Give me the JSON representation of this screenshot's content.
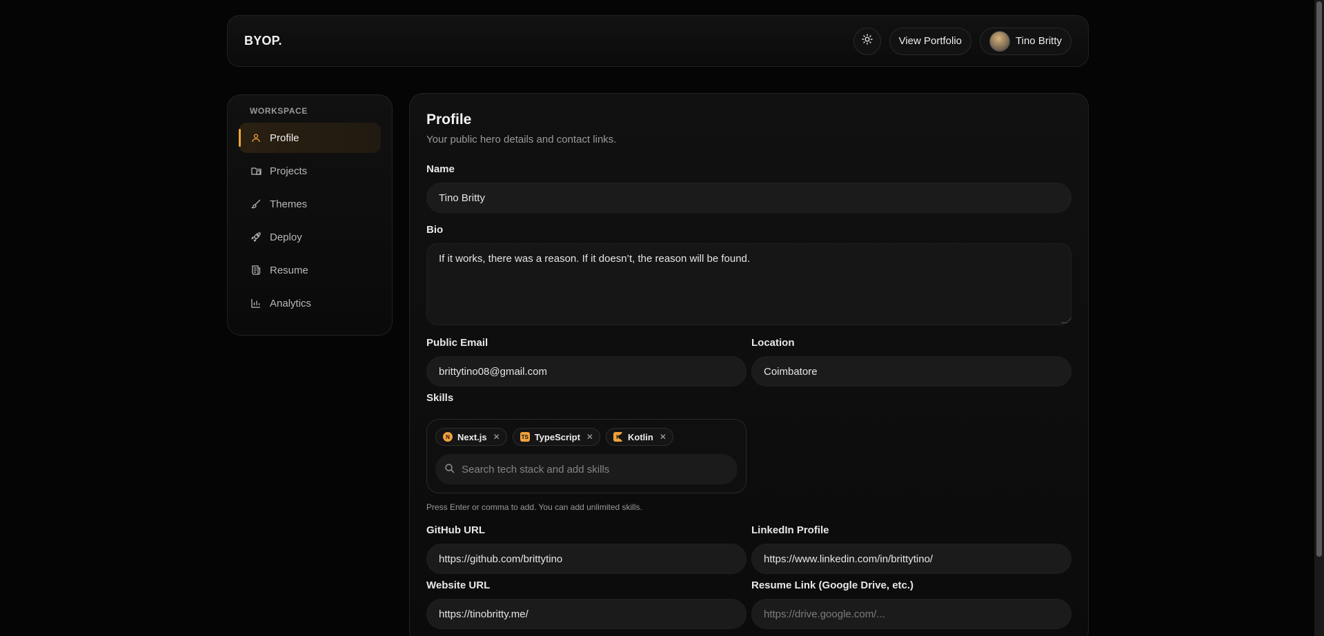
{
  "header": {
    "brand": "BYOP.",
    "view_portfolio": "View Portfolio",
    "user_name": "Tino Britty"
  },
  "sidebar": {
    "section_label": "WORKSPACE",
    "items": [
      {
        "label": "Profile",
        "icon": "user-icon",
        "active": true
      },
      {
        "label": "Projects",
        "icon": "folder-icon"
      },
      {
        "label": "Themes",
        "icon": "brush-icon"
      },
      {
        "label": "Deploy",
        "icon": "rocket-icon"
      },
      {
        "label": "Resume",
        "icon": "document-icon"
      },
      {
        "label": "Analytics",
        "icon": "bar-chart-icon"
      }
    ]
  },
  "profile": {
    "title": "Profile",
    "subtitle": "Your public hero details and contact links.",
    "name_label": "Name",
    "name_value": "Tino Britty",
    "bio_label": "Bio",
    "bio_value": "If it works, there was a reason. If it doesn’t, the reason will be found.",
    "email_label": "Public Email",
    "email_value": "brittytino08@gmail.com",
    "location_label": "Location",
    "location_value": "Coimbatore",
    "skills_label": "Skills",
    "skills": [
      {
        "name": "Next.js",
        "logo": "N"
      },
      {
        "name": "TypeScript",
        "logo": "TS"
      },
      {
        "name": "Kotlin",
        "logo": "K"
      }
    ],
    "skills_placeholder": "Search tech stack and add skills",
    "skills_hint": "Press Enter or comma to add. You can add unlimited skills.",
    "github_label": "GitHub URL",
    "github_value": "https://github.com/brittytino",
    "linkedin_label": "LinkedIn Profile",
    "linkedin_value": "https://www.linkedin.com/in/brittytino/",
    "website_label": "Website URL",
    "website_value": "https://tinobritty.me/",
    "resume_label": "Resume Link (Google Drive, etc.)",
    "resume_placeholder": "https://drive.google.com/..."
  },
  "colors": {
    "accent": "#f0a23b",
    "background": "#050505",
    "field": "#1b1b1b"
  }
}
